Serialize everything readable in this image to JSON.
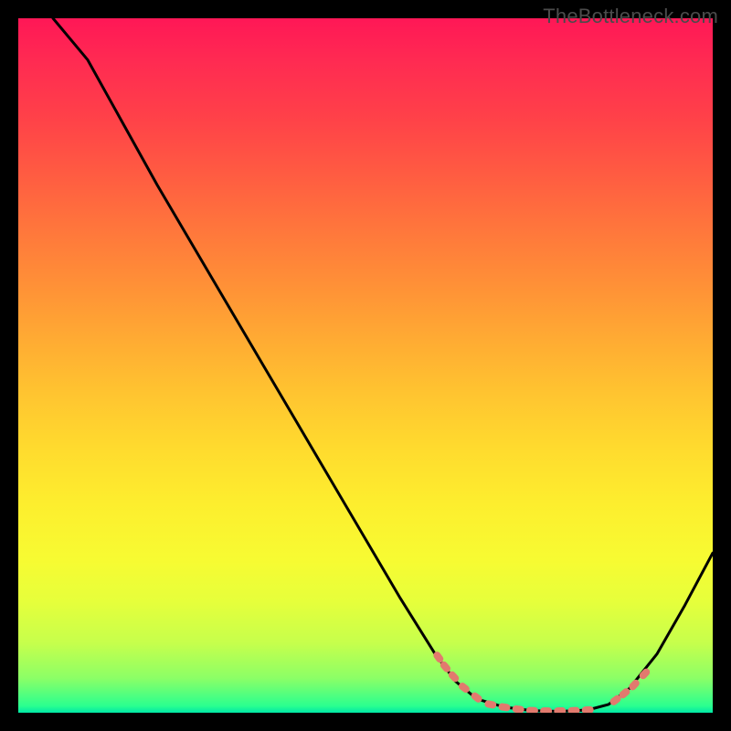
{
  "watermark": "TheBottleneck.com",
  "chart_data": {
    "type": "line",
    "title": "",
    "xlabel": "",
    "ylabel": "",
    "xlim": [
      0,
      100
    ],
    "ylim": [
      0,
      100
    ],
    "gradient_note": "Background vertical gradient red→yellow→green indicates bottleneck severity (top=high, bottom=low).",
    "series": [
      {
        "name": "bottleneck-curve",
        "color": "#000000",
        "x": [
          5,
          10,
          15,
          20,
          25,
          30,
          35,
          40,
          45,
          50,
          55,
          60,
          63,
          66,
          70,
          74,
          78,
          82,
          85,
          88,
          92,
          96,
          100
        ],
        "y": [
          100,
          94,
          85,
          76,
          67.5,
          59,
          50.5,
          42,
          33.5,
          25,
          16.5,
          8.5,
          4.5,
          2,
          0.8,
          0.3,
          0.2,
          0.4,
          1.2,
          3.5,
          8.5,
          15.5,
          23
        ]
      }
    ],
    "dotted_segments": [
      {
        "name": "optimal-range-left",
        "color": "#e27a6e",
        "x": [
          60.5,
          61.5,
          62.7,
          64.2,
          66
        ],
        "y": [
          8.0,
          6.6,
          5.2,
          3.6,
          2.2
        ]
      },
      {
        "name": "optimal-range-floor",
        "color": "#e27a6e",
        "x": [
          68,
          70,
          72,
          74,
          76,
          78,
          80,
          82
        ],
        "y": [
          1.2,
          0.8,
          0.5,
          0.3,
          0.25,
          0.25,
          0.3,
          0.4
        ]
      },
      {
        "name": "optimal-range-right",
        "color": "#e27a6e",
        "x": [
          86,
          87.3,
          88.7,
          90.2
        ],
        "y": [
          1.8,
          2.8,
          4.0,
          5.6
        ]
      }
    ]
  }
}
